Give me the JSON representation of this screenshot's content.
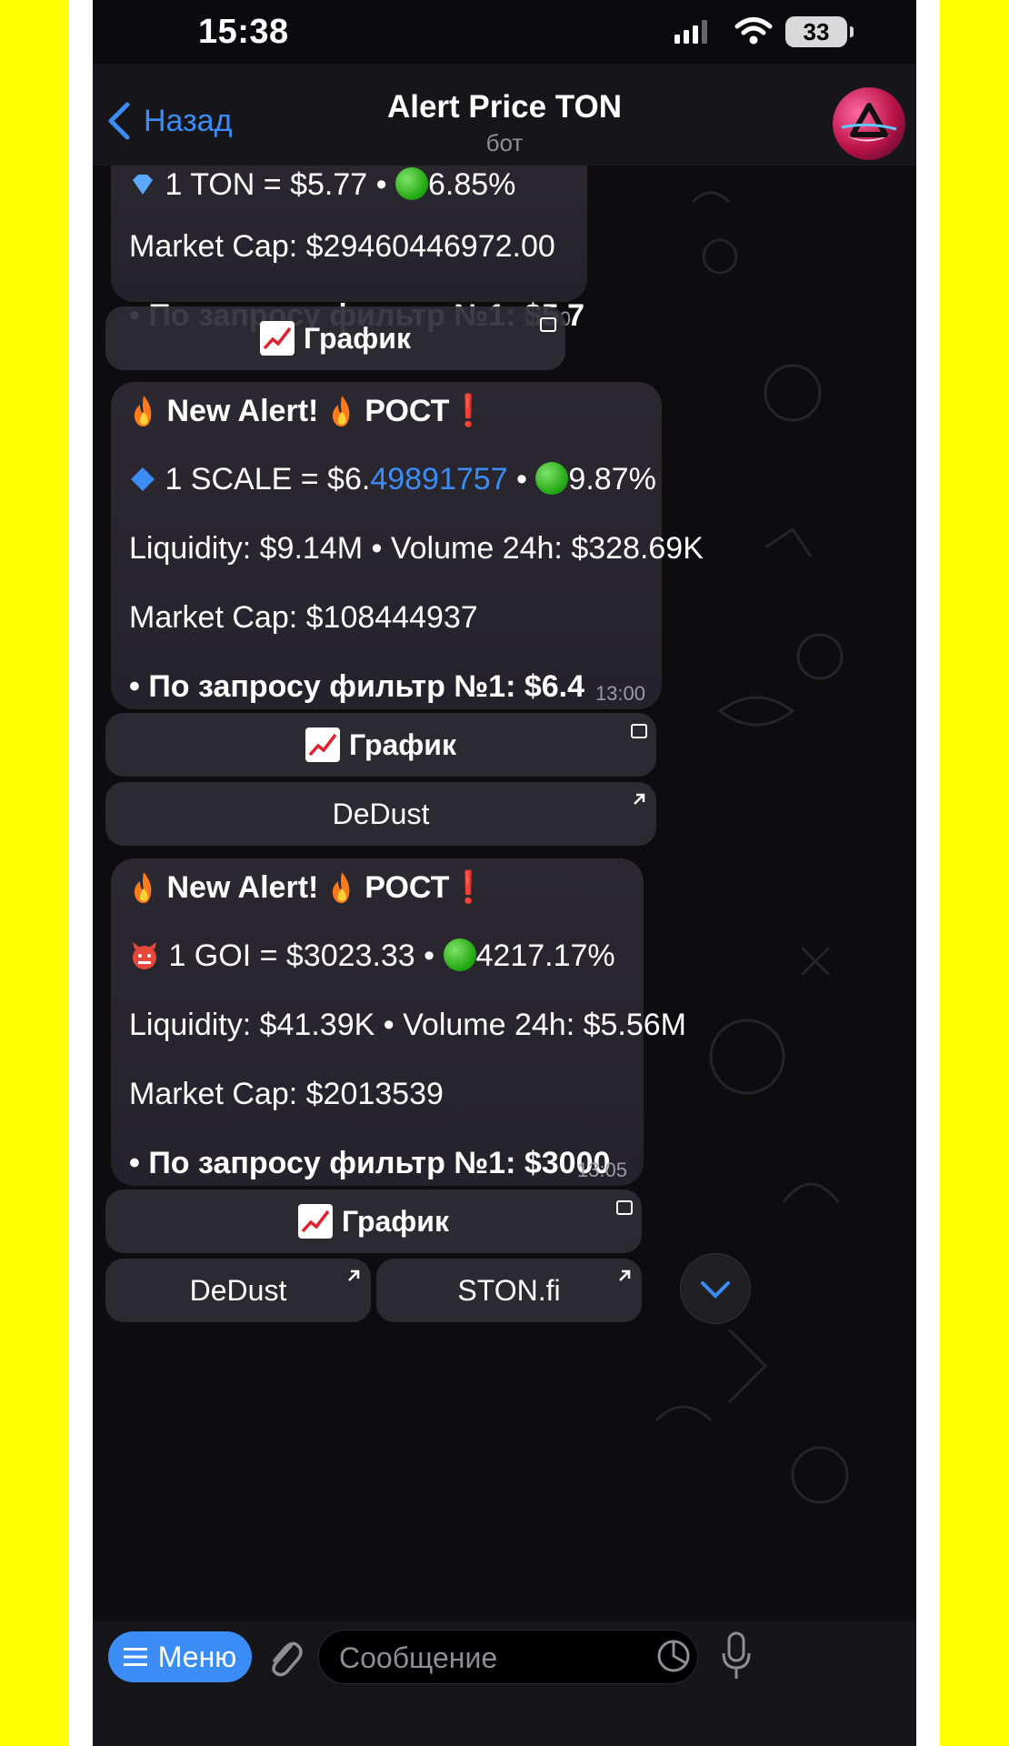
{
  "status_bar": {
    "time": "15:38",
    "battery": "33"
  },
  "header": {
    "back_label": "Назад",
    "title": "Alert Price TON",
    "subtitle": "бот"
  },
  "messages": [
    {
      "price_line": "1 TON = $5.77",
      "percent": "6.85%",
      "market_cap": "Market Cap: $29460446972.00",
      "filter": "• По запросу фильтр №1: $5.7",
      "time": "13:00",
      "buttons": [
        "📈 График"
      ]
    },
    {
      "alert_prefix": "New Alert!",
      "alert_word": "РОСТ",
      "price_prefix": "1 SCALE = $6.",
      "price_link": "49891757",
      "percent": "9.87%",
      "liquidity": "Liquidity: $9.14M",
      "volume": "Volume 24h: $328.69K",
      "market_cap": "Market Cap: $108444937",
      "filter": "• По запросу фильтр №1: $6.4",
      "time": "13:00",
      "buttons": [
        "График",
        "DeDust"
      ]
    },
    {
      "alert_prefix": "New Alert!",
      "alert_word": "РОСТ",
      "price_line": "1 GOI = $3023.33",
      "percent": "4217.17%",
      "liquidity": "Liquidity: $41.39K",
      "volume": "Volume 24h: $5.56M",
      "market_cap": "Market Cap: $2013539",
      "filter": "• По запросу фильтр №1: $3000",
      "time": "13:05",
      "buttons": [
        "График",
        "DeDust",
        "STON.fi"
      ]
    }
  ],
  "input": {
    "menu_label": "Меню",
    "placeholder": "Сообщение"
  },
  "colors": {
    "accent": "#3b8df5",
    "bubble": "#2b2830",
    "background": "#0d0d10",
    "frame": "#ffff00"
  },
  "icons": [
    "signal-icon",
    "wifi-icon",
    "battery-icon",
    "back-chevron-icon",
    "avatar",
    "gem-icon",
    "fire-icon",
    "green-circle-icon",
    "chart-emoji-icon",
    "open-app-icon",
    "external-link-icon",
    "demon-icon",
    "scroll-down-icon",
    "menu-icon",
    "attach-icon",
    "sticker-icon",
    "mic-icon"
  ]
}
